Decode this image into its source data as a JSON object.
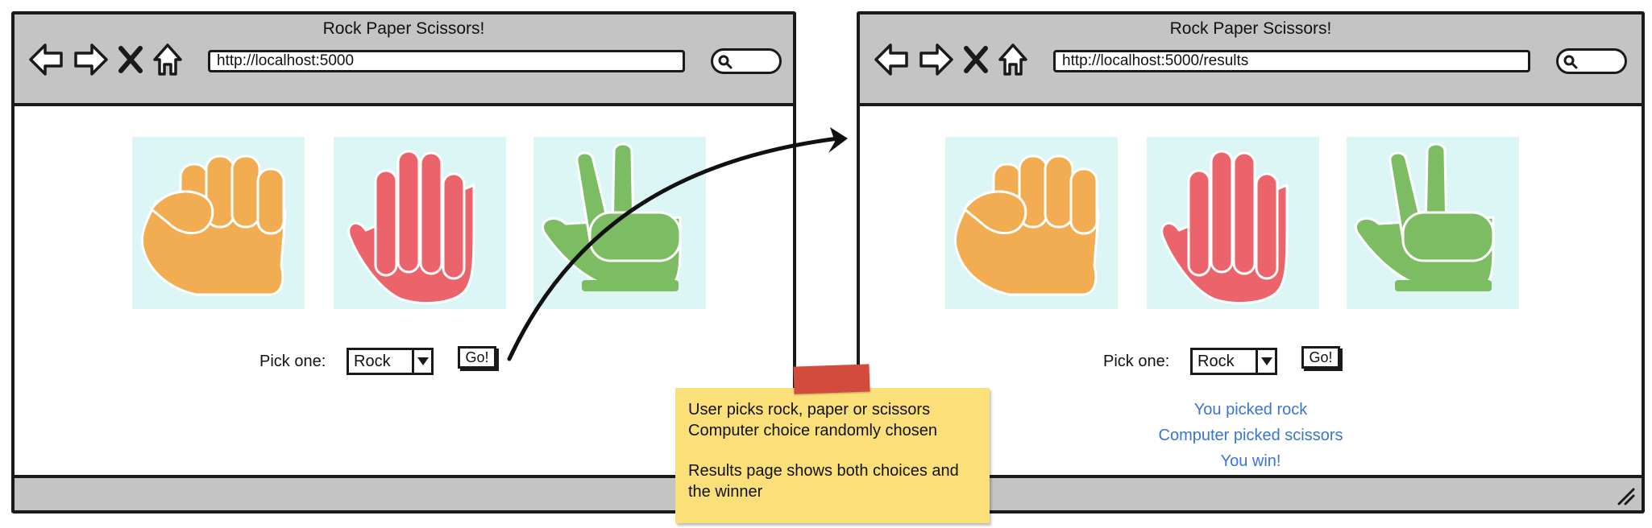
{
  "left_window": {
    "title": "Rock Paper Scissors!",
    "url": "http://localhost:5000",
    "pick_label": "Pick one:",
    "select_value": "Rock",
    "go_label": "Go!"
  },
  "right_window": {
    "title": "Rock Paper Scissors!",
    "url": "http://localhost:5000/results",
    "pick_label": "Pick one:",
    "select_value": "Rock",
    "go_label": "Go!",
    "results": [
      "You picked rock",
      "Computer picked scissors",
      "You win!"
    ]
  },
  "icons": {
    "back": "arrow-left-icon",
    "forward": "arrow-right-icon",
    "stop": "x-icon",
    "home": "home-icon",
    "search": "magnifier-icon",
    "rock": "fist-icon",
    "paper": "open-hand-icon",
    "scissors": "peace-hand-icon"
  },
  "colors": {
    "rock": "#f2ad52",
    "paper": "#ec646b",
    "scissors": "#7cbd63",
    "tile_bg": "#dcf5f5",
    "result_text": "#3a74d4",
    "note_bg": "#fbe07a",
    "tape": "#d24b3c"
  },
  "note": {
    "line1": "User picks rock, paper or scissors",
    "line2": "Computer choice randomly chosen",
    "line3": "Results page shows both choices and",
    "line4": "the winner"
  }
}
